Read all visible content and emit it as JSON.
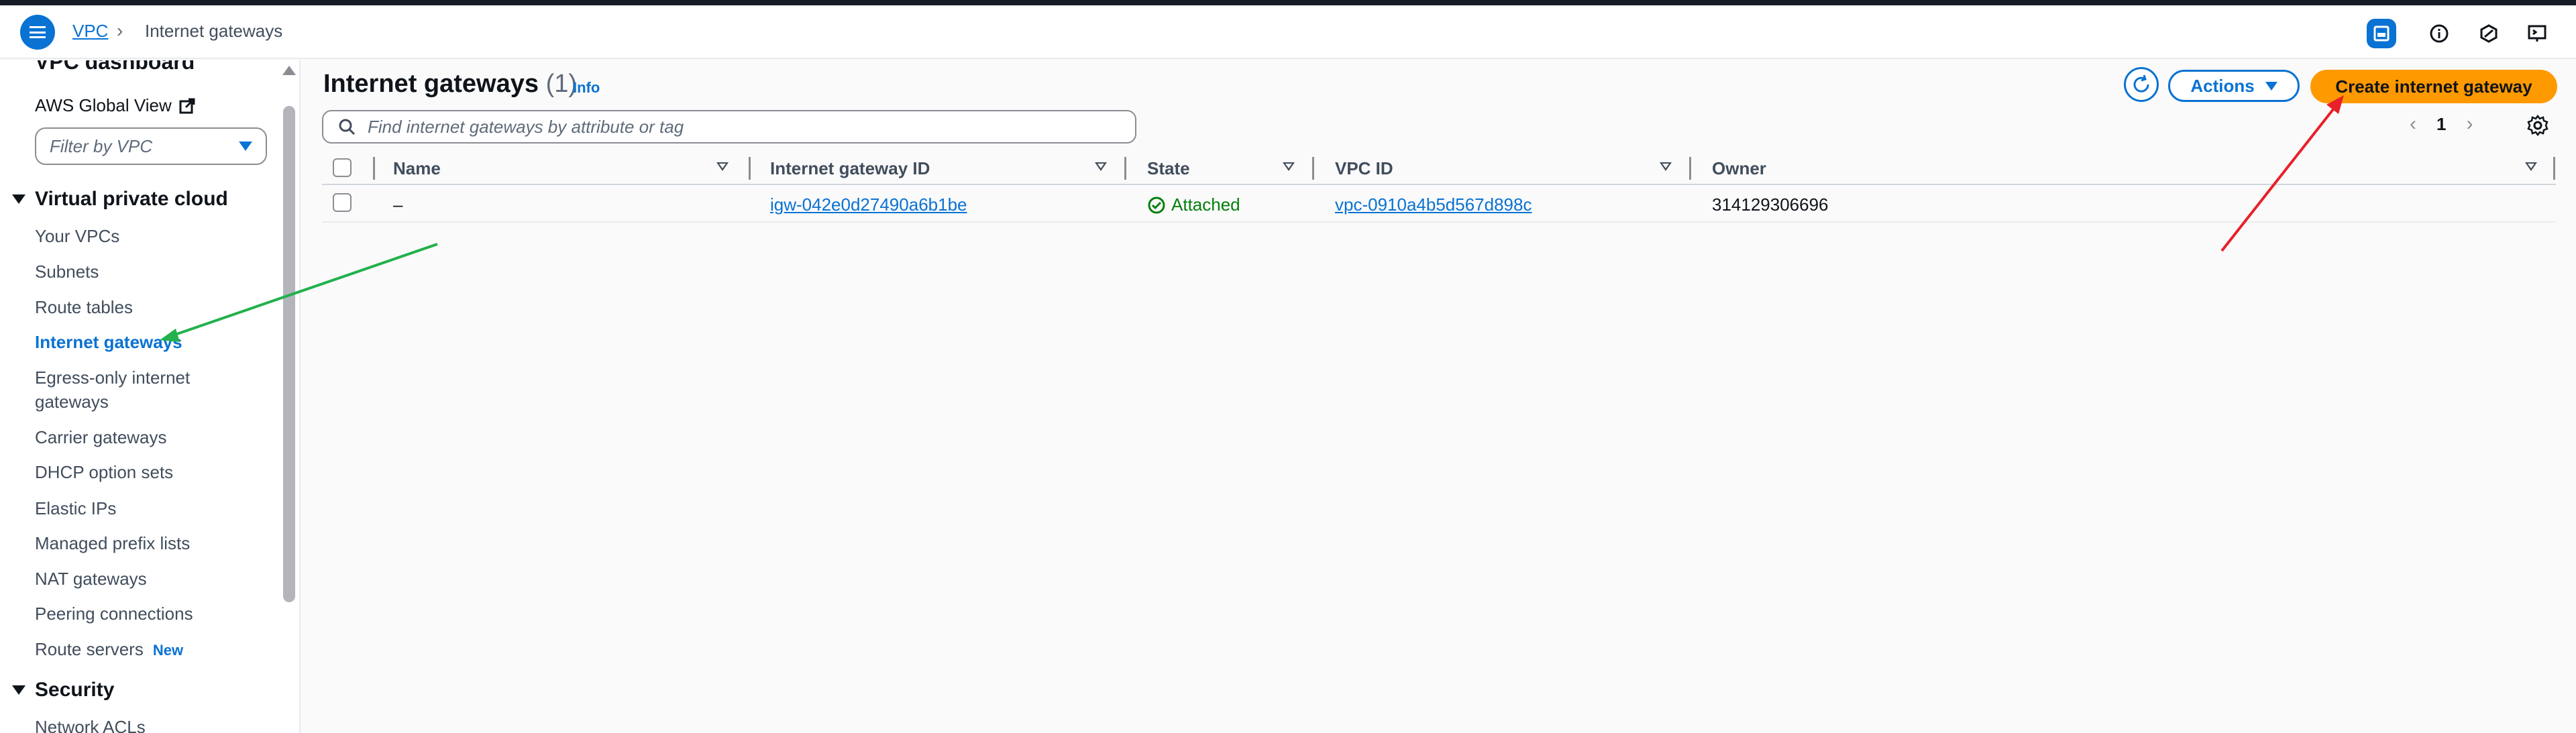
{
  "header": {
    "breadcrumb_root": "VPC",
    "breadcrumb_separator": "›",
    "breadcrumb_current": "Internet gateways"
  },
  "sidebar": {
    "dashboard_label": "VPC dashboard",
    "global_view_label": "AWS Global View",
    "filter_placeholder": "Filter by VPC",
    "section_vpc": "Virtual private cloud",
    "items": [
      {
        "label": "Your VPCs"
      },
      {
        "label": "Subnets"
      },
      {
        "label": "Route tables"
      },
      {
        "label": "Internet gateways"
      },
      {
        "label": "Egress-only internet gateways"
      },
      {
        "label": "Carrier gateways"
      },
      {
        "label": "DHCP option sets"
      },
      {
        "label": "Elastic IPs"
      },
      {
        "label": "Managed prefix lists"
      },
      {
        "label": "NAT gateways"
      },
      {
        "label": "Peering connections"
      },
      {
        "label": "Route servers",
        "badge": "New"
      }
    ],
    "section_security": "Security",
    "security_items": [
      {
        "label": "Network ACLs"
      }
    ]
  },
  "main": {
    "title": "Internet gateways",
    "count": "(1)",
    "info_label": "Info",
    "actions_label": "Actions",
    "create_label": "Create internet gateway",
    "search_placeholder": "Find internet gateways by attribute or tag",
    "page_number": "1"
  },
  "table": {
    "columns": [
      "Name",
      "Internet gateway ID",
      "State",
      "VPC ID",
      "Owner"
    ],
    "rows": [
      {
        "name": "–",
        "igw_id": "igw-042e0d27490a6b1be",
        "state": "Attached",
        "vpc_id": "vpc-0910a4b5d567d898c",
        "owner": "314129306696"
      }
    ]
  },
  "colors": {
    "accent": "#0972d3",
    "primary_button": "#ff9900",
    "success": "#037f0c",
    "annotation_red": "#e8202a",
    "annotation_green": "#22b14c"
  }
}
